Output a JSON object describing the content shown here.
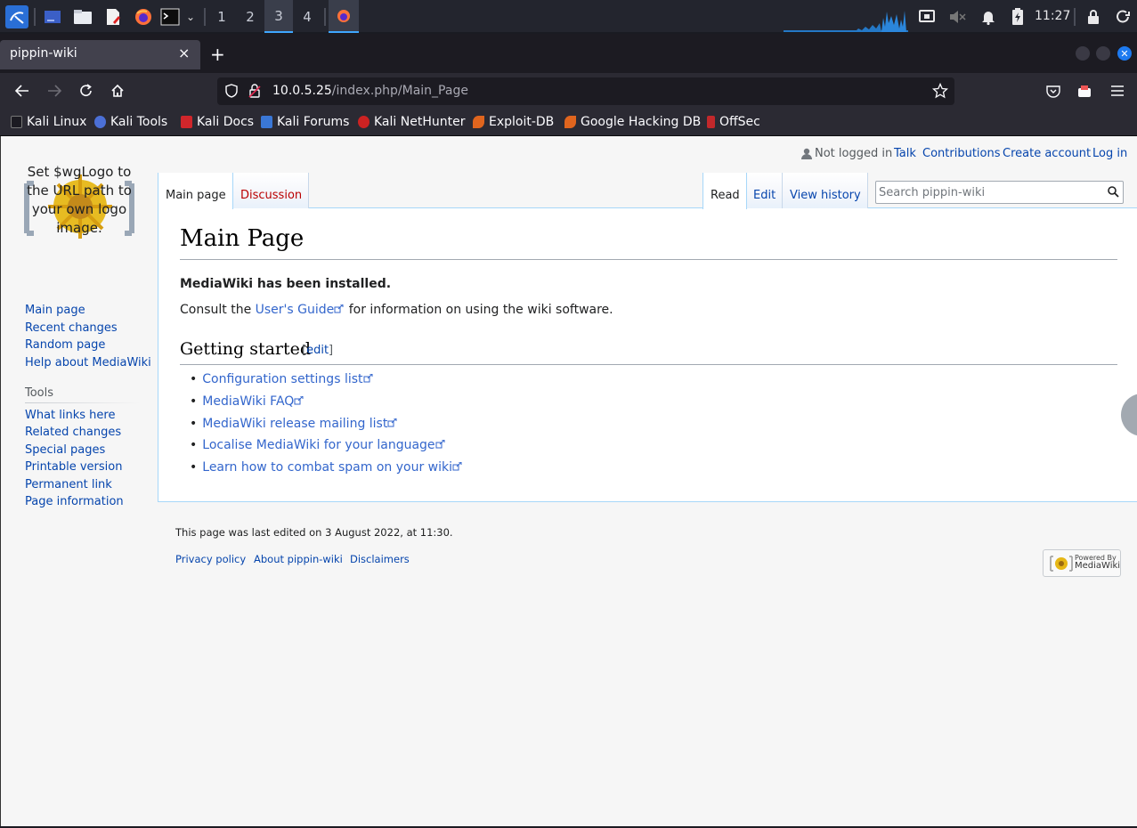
{
  "taskbar": {
    "workspaces": [
      "1",
      "2",
      "3",
      "4"
    ],
    "active_workspace": "3",
    "clock": "11:27"
  },
  "browser": {
    "tab_title": "pippin-wiki",
    "tab_close": "×",
    "new_tab": "+",
    "url_host": "10.0.5.25",
    "url_path": "/index.php/Main_Page",
    "bookmarks": [
      "Kali Linux",
      "Kali Tools",
      "Kali Docs",
      "Kali Forums",
      "Kali NetHunter",
      "Exploit-DB",
      "Google Hacking DB",
      "OffSec"
    ]
  },
  "wiki": {
    "personal": {
      "not_logged_in": "Not logged in",
      "talk": "Talk",
      "contributions": "Contributions",
      "create_account": "Create account",
      "log_in": "Log in"
    },
    "logo_text": "Set $wgLogo to the URL path to your own logo image.",
    "tabs": {
      "main_page": "Main page",
      "discussion": "Discussion",
      "read": "Read",
      "edit": "Edit",
      "view_history": "View history"
    },
    "search_placeholder": "Search pippin-wiki",
    "navigation": [
      "Main page",
      "Recent changes",
      "Random page",
      "Help about MediaWiki"
    ],
    "tools_heading": "Tools",
    "tools": [
      "What links here",
      "Related changes",
      "Special pages",
      "Printable version",
      "Permanent link",
      "Page information"
    ],
    "title": "Main Page",
    "installed": "MediaWiki has been installed.",
    "consult_prefix": "Consult the ",
    "consult_link": "User's Guide",
    "consult_suffix": " for information on using the wiki software.",
    "section_heading": "Getting started",
    "edit_open": "[",
    "edit_label": "edit",
    "edit_close": "]",
    "links": [
      "Configuration settings list",
      "MediaWiki FAQ",
      "MediaWiki release mailing list",
      "Localise MediaWiki for your language",
      "Learn how to combat spam on your wiki"
    ],
    "last_edited": "This page was last edited on 3 August 2022, at 11:30.",
    "footer_links": [
      "Privacy policy",
      "About pippin-wiki",
      "Disclaimers"
    ],
    "powered_by": "Powered By",
    "powered_by_name": "MediaWiki"
  },
  "colors": {
    "link": "#0645ad",
    "new_link": "#ba0000",
    "taskbar_bg": "#23252e",
    "accent": "#3fa7ff"
  }
}
